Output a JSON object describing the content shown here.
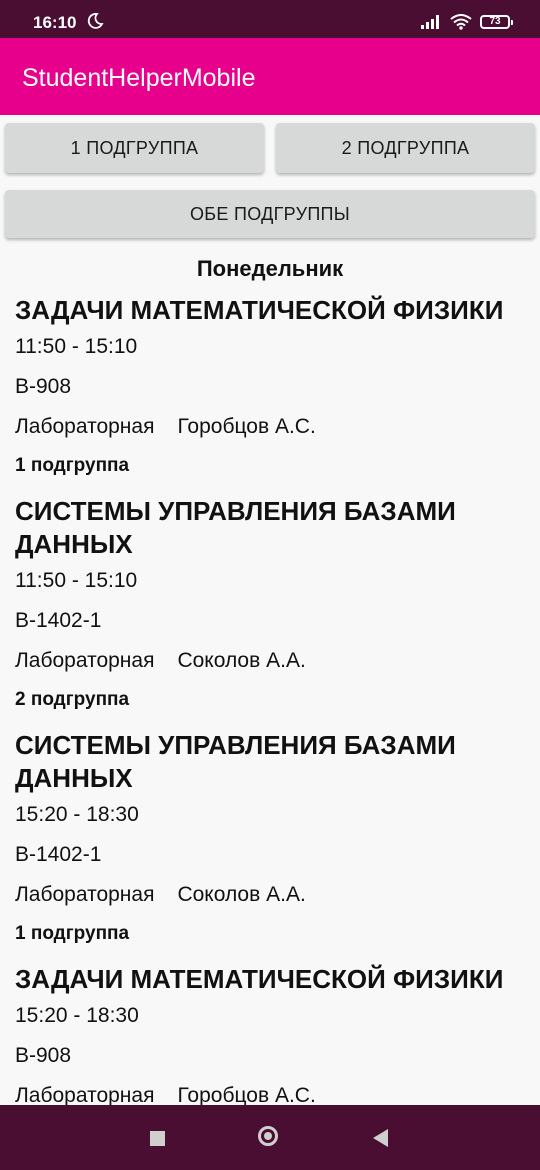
{
  "status_bar": {
    "time": "16:10",
    "battery": "73",
    "icons": [
      "moon-icon",
      "signal-icon",
      "wifi-icon",
      "battery-icon"
    ]
  },
  "app_bar": {
    "title": "StudentHelperMobile"
  },
  "buttons": {
    "group1": "1 ПОДГРУППА",
    "group2": "2 ПОДГРУППА",
    "both": "ОБЕ ПОДГРУППЫ"
  },
  "schedule": {
    "day": "Понедельник",
    "lessons": [
      {
        "title": "ЗАДАЧИ МАТЕМАТИЧЕСКОЙ ФИЗИКИ",
        "time": "11:50  - 15:10",
        "room": "В-908",
        "type": "Лабораторная",
        "teacher": "Горобцов А.С.",
        "group": "1 подгруппа"
      },
      {
        "title": "СИСТЕМЫ УПРАВЛЕНИЯ БАЗАМИ ДАННЫХ",
        "time": "11:50  - 15:10",
        "room": "В-1402-1",
        "type": "Лабораторная",
        "teacher": "Соколов А.А.",
        "group": "2 подгруппа"
      },
      {
        "title": "СИСТЕМЫ УПРАВЛЕНИЯ БАЗАМИ ДАННЫХ",
        "time": "15:20  - 18:30",
        "room": "В-1402-1",
        "type": "Лабораторная",
        "teacher": "Соколов А.А.",
        "group": "1 подгруппа"
      },
      {
        "title": "ЗАДАЧИ МАТЕМАТИЧЕСКОЙ ФИЗИКИ",
        "time": "15:20  - 18:30",
        "room": "В-908",
        "type": "Лабораторная",
        "teacher": "Горобцов А.С.",
        "group": ""
      }
    ]
  },
  "nav_bar": {
    "icons": [
      "recents-square-icon",
      "home-circle-icon",
      "back-triangle-icon"
    ]
  },
  "colors": {
    "status_bar": "#4a0e33",
    "app_bar": "#e6008c",
    "button": "#d7d8d8",
    "background": "#f8f8f8"
  }
}
